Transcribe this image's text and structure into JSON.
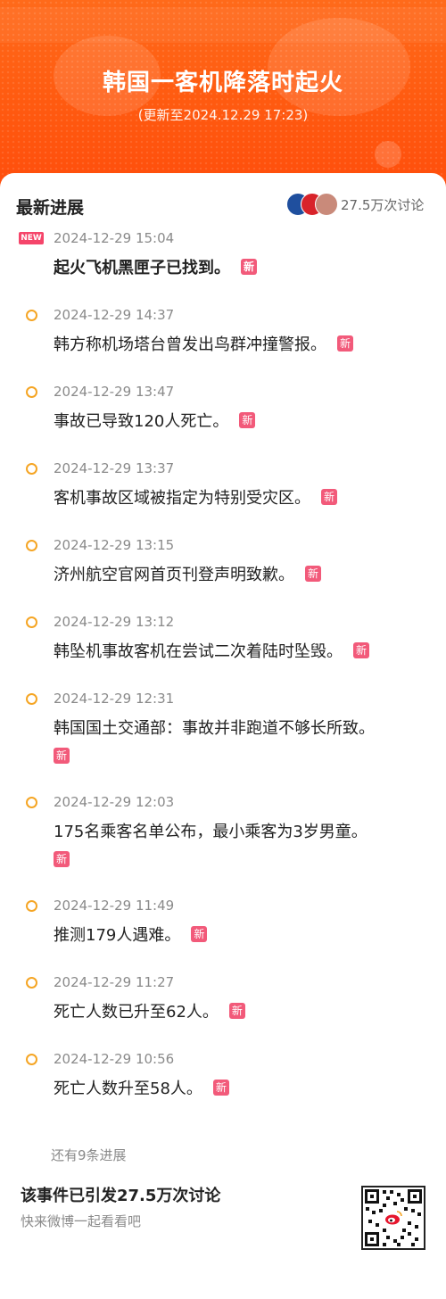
{
  "header": {
    "title": "韩国一客机降落时起火",
    "subtitle": "(更新至2024.12.29 17:23)"
  },
  "section": {
    "title": "最新进展",
    "discussion": "27.5万次讨论"
  },
  "new_badge": "NEW",
  "new_tag": "新",
  "timeline": [
    {
      "time": "2024-12-29 15:04",
      "text": "起火飞机黑匣子已找到。"
    },
    {
      "time": "2024-12-29 14:37",
      "text": "韩方称机场塔台曾发出鸟群冲撞警报。"
    },
    {
      "time": "2024-12-29 13:47",
      "text": "事故已导致120人死亡。"
    },
    {
      "time": "2024-12-29 13:37",
      "text": "客机事故区域被指定为特别受灾区。"
    },
    {
      "time": "2024-12-29 13:15",
      "text": "济州航空官网首页刊登声明致歉。"
    },
    {
      "time": "2024-12-29 13:12",
      "text": "韩坠机事故客机在尝试二次着陆时坠毁。"
    },
    {
      "time": "2024-12-29 12:31",
      "text": "韩国国土交通部：事故并非跑道不够长所致。"
    },
    {
      "time": "2024-12-29 12:03",
      "text": "175名乘客名单公布，最小乘客为3岁男童。"
    },
    {
      "time": "2024-12-29 11:49",
      "text": "推测179人遇难。"
    },
    {
      "time": "2024-12-29 11:27",
      "text": "死亡人数已升至62人。"
    },
    {
      "time": "2024-12-29 10:56",
      "text": "死亡人数升至58人。"
    }
  ],
  "more": "还有9条进展",
  "footer": {
    "title": "该事件已引发27.5万次讨论",
    "subtitle": "快来微博一起看看吧"
  },
  "colors": {
    "header": "#ff5a10",
    "timeline_dot": "#f5a524",
    "new_tag": "#f25a7a"
  }
}
